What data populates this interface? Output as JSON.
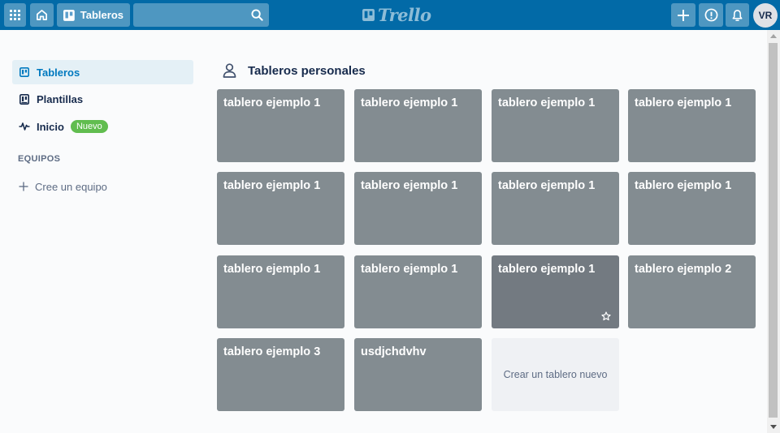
{
  "header": {
    "boards_label": "Tableros",
    "search_value": "",
    "logo_text": "Trello",
    "avatar_initials": "VR"
  },
  "icons": {
    "apps": "grid-icon",
    "home": "home-icon",
    "boards": "board-icon",
    "search": "search-icon",
    "create": "plus-icon",
    "info": "info-icon",
    "notifications": "bell-icon"
  },
  "sidebar": {
    "items": [
      {
        "label": "Tableros",
        "icon": "board-icon",
        "active": true
      },
      {
        "label": "Plantillas",
        "icon": "template-icon"
      },
      {
        "label": "Inicio",
        "icon": "activity-icon",
        "badge": "Nuevo"
      }
    ],
    "teams_heading": "EQUIPOS",
    "create_team": "Cree un equipo"
  },
  "main": {
    "section_title": "Tableros personales",
    "boards": [
      "tablero ejemplo 1",
      "tablero ejemplo 1",
      "tablero ejemplo 1",
      "tablero ejemplo 1",
      "tablero ejemplo 1",
      "tablero ejemplo 1",
      "tablero ejemplo 1",
      "tablero ejemplo 1",
      "tablero ejemplo 1",
      "tablero ejemplo 1",
      "tablero ejemplo 1",
      "tablero ejemplo 2",
      "tablero ejemplo 3",
      "usdjchdvhv"
    ],
    "create_board": "Crear un tablero nuevo"
  },
  "colors": {
    "header_bg": "#026aa7",
    "tile_bg": "#838c91",
    "tile_hover_bg": "#737a81",
    "active_nav_bg": "#e4f0f6",
    "active_nav_text": "#0079bf",
    "badge_green": "#61bd4f"
  }
}
